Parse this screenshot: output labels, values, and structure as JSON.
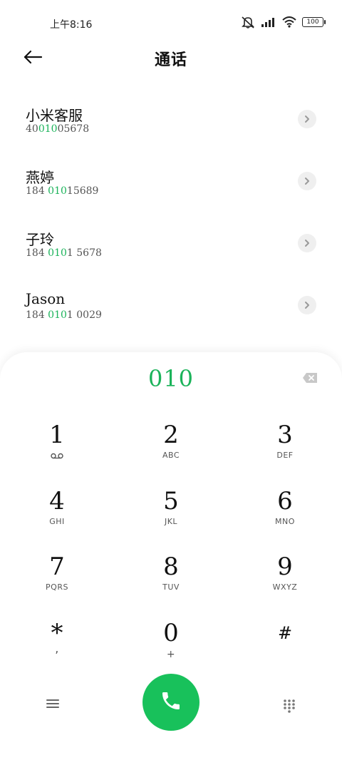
{
  "status_bar": {
    "time": "上午8:16",
    "battery": "100"
  },
  "header": {
    "title": "通话"
  },
  "contacts": [
    {
      "name": "小米客服",
      "number_pre": "40",
      "number_match": "010",
      "number_post": "05678"
    },
    {
      "name": "燕婷",
      "number_pre": "184 ",
      "number_match": "010",
      "number_post": "15689"
    },
    {
      "name": "子玲",
      "number_pre": "184 ",
      "number_match": "010",
      "number_post": "1 5678"
    },
    {
      "name": "Jason",
      "number_pre": "184 ",
      "number_match": "010",
      "number_post": "1 0029"
    }
  ],
  "dialer": {
    "input": "010",
    "keys": [
      {
        "digit": "1",
        "letters": ""
      },
      {
        "digit": "2",
        "letters": "ABC"
      },
      {
        "digit": "3",
        "letters": "DEF"
      },
      {
        "digit": "4",
        "letters": "GHI"
      },
      {
        "digit": "5",
        "letters": "JKL"
      },
      {
        "digit": "6",
        "letters": "MNO"
      },
      {
        "digit": "7",
        "letters": "PQRS"
      },
      {
        "digit": "8",
        "letters": "TUV"
      },
      {
        "digit": "9",
        "letters": "WXYZ"
      },
      {
        "digit": "*",
        "letters": ","
      },
      {
        "digit": "0",
        "letters": "+"
      },
      {
        "digit": "#",
        "letters": ""
      }
    ]
  },
  "colors": {
    "accent": "#1bb35a",
    "call_button": "#18c15b"
  },
  "icons": {
    "back": "arrow-left-icon",
    "chevron": "chevron-right-icon",
    "backspace": "backspace-icon",
    "voicemail": "voicemail-icon",
    "menu": "menu-icon",
    "call": "phone-icon",
    "keypad": "dialpad-icon"
  }
}
